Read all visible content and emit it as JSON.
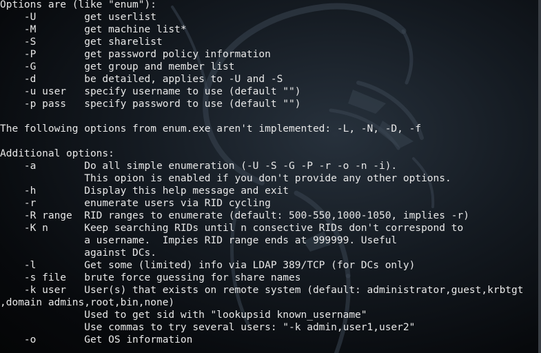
{
  "terminal": {
    "lines": [
      "Options are (like \"enum\"):",
      "    -U        get userlist",
      "    -M        get machine list*",
      "    -S        get sharelist",
      "    -P        get password policy information",
      "    -G        get group and member list",
      "    -d        be detailed, applies to -U and -S",
      "    -u user   specify username to use (default \"\")",
      "    -p pass   specify password to use (default \"\")",
      "",
      "The following options from enum.exe aren't implemented: -L, -N, -D, -f",
      "",
      "Additional options:",
      "    -a        Do all simple enumeration (-U -S -G -P -r -o -n -i).",
      "              This opion is enabled if you don't provide any other options.",
      "    -h        Display this help message and exit",
      "    -r        enumerate users via RID cycling",
      "    -R range  RID ranges to enumerate (default: 500-550,1000-1050, implies -r)",
      "    -K n      Keep searching RIDs until n consective RIDs don't correspond to",
      "              a username.  Impies RID range ends at 999999. Useful",
      "              against DCs.",
      "    -l        Get some (limited) info via LDAP 389/TCP (for DCs only)",
      "    -s file   brute force guessing for share names",
      "    -k user   User(s) that exists on remote system (default: administrator,guest,krbtgt",
      ",domain admins,root,bin,none)",
      "              Used to get sid with \"lookupsid known_username\"",
      "              Use commas to try several users: \"-k admin,user1,user2\"",
      "    -o        Get OS information"
    ]
  }
}
